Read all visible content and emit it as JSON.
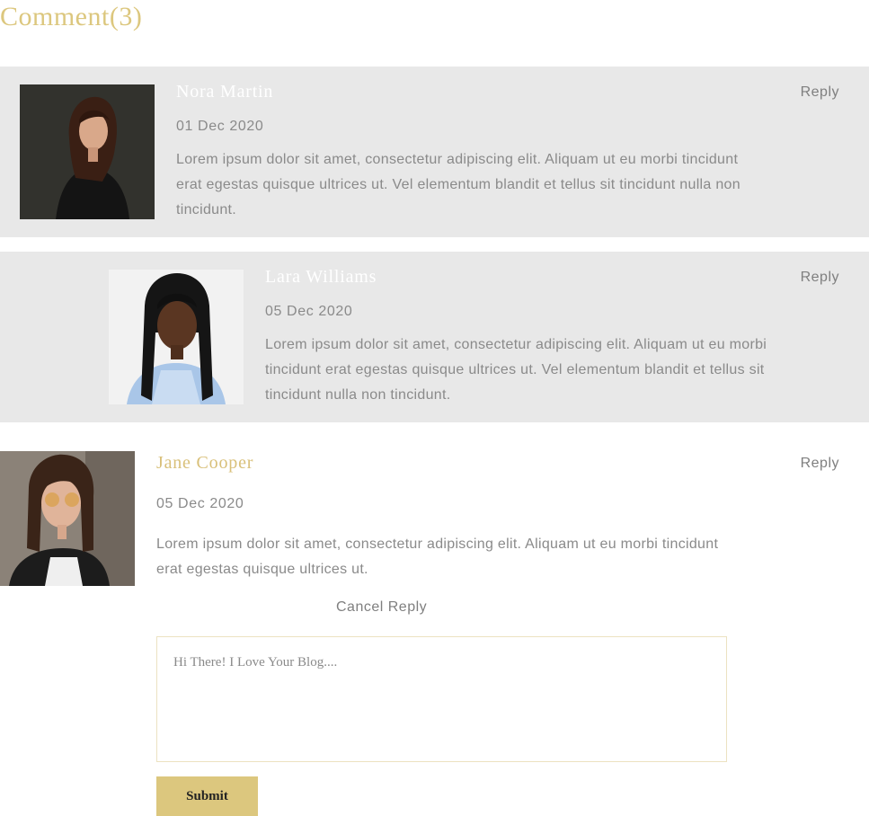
{
  "section": {
    "heading": "Comment(3)"
  },
  "comments": [
    {
      "author": "Nora Martin",
      "date": "01 Dec 2020",
      "text": "Lorem ipsum dolor sit amet, consectetur adipiscing elit. Aliquam ut eu morbi tincidunt erat egestas quisque ultrices ut. Vel elementum blandit et tellus sit tincidunt nulla non tincidunt.",
      "reply_label": "Reply"
    },
    {
      "author": "Lara Williams",
      "date": "05 Dec 2020",
      "text": "Lorem ipsum dolor sit amet, consectetur adipiscing elit. Aliquam ut eu morbi tincidunt erat egestas quisque ultrices ut. Vel elementum blandit et tellus sit tincidunt nulla non tincidunt.",
      "reply_label": "Reply"
    },
    {
      "author": "Jane Cooper",
      "date": "05 Dec 2020",
      "text": "Lorem ipsum dolor sit amet, consectetur adipiscing elit. Aliquam ut eu morbi tincidunt erat egestas quisque ultrices ut.",
      "reply_label": "Reply"
    }
  ],
  "reply_form": {
    "cancel_label": "Cancel Reply",
    "placeholder": "Hi There! I Love Your Blog....",
    "submit_label": "Submit"
  },
  "colors": {
    "accent": "#dcc77e",
    "shaded_background": "#e8e8e8",
    "muted_text": "#8a8a8a"
  }
}
